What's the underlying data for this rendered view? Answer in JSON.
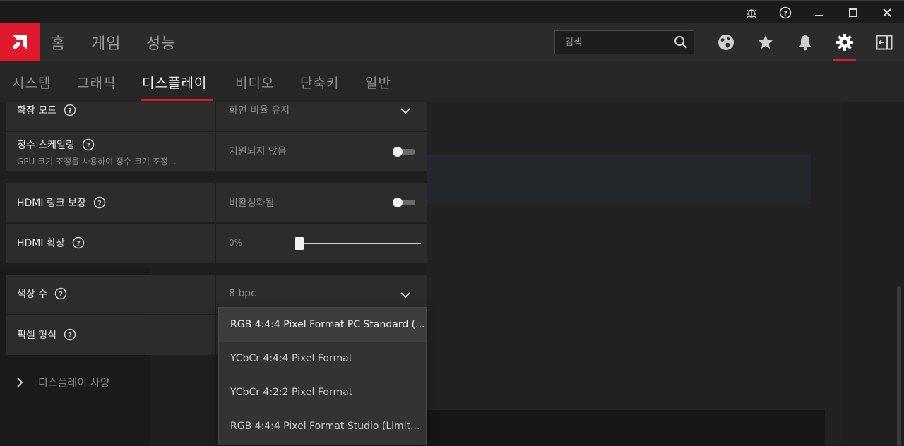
{
  "titlebar": {
    "icons": [
      "bug-icon",
      "help-icon",
      "minimize-icon",
      "maximize-icon",
      "close-icon"
    ]
  },
  "nav": {
    "main_tabs": [
      {
        "label": "홈"
      },
      {
        "label": "게임"
      },
      {
        "label": "성능"
      }
    ],
    "search_placeholder": "검색",
    "right_icons": [
      "globe-icon",
      "star-icon",
      "bell-icon",
      "gear-icon",
      "sidebar-toggle-icon"
    ],
    "accent": "#e0192d"
  },
  "subnav": {
    "tabs": [
      {
        "label": "시스템"
      },
      {
        "label": "그래픽"
      },
      {
        "label": "디스플레이"
      },
      {
        "label": "비디오"
      },
      {
        "label": "단축키"
      },
      {
        "label": "일반"
      }
    ],
    "active_index": 2
  },
  "settings": {
    "scaling_mode": {
      "label": "확장 모드",
      "value": "화면 비율 유지"
    },
    "integer_scaling": {
      "label": "정수 스케일링",
      "sublabel": "GPU 크기 조정을 사용하여 정수 크기 조정...",
      "value": "지원되지 않음",
      "enabled": false
    },
    "hdmi_link": {
      "label": "HDMI 링크 보장",
      "value": "비활성화됨",
      "enabled": false
    },
    "hdmi_scaling": {
      "label": "HDMI 확장",
      "value": "0%",
      "level": 0
    },
    "color_depth": {
      "label": "색상 수",
      "value": "8 bpc"
    },
    "pixel_format": {
      "label": "픽셀 형식"
    },
    "display_specs": {
      "label": "디스플레이 사양"
    }
  },
  "dropdown": {
    "options": [
      "RGB 4:4:4 Pixel Format PC Standard (...",
      "YCbCr 4:4:4 Pixel Format",
      "YCbCr 4:2:2 Pixel Format",
      "RGB 4:4:4 Pixel Format Studio (Limit..."
    ],
    "selected_index": 0
  }
}
